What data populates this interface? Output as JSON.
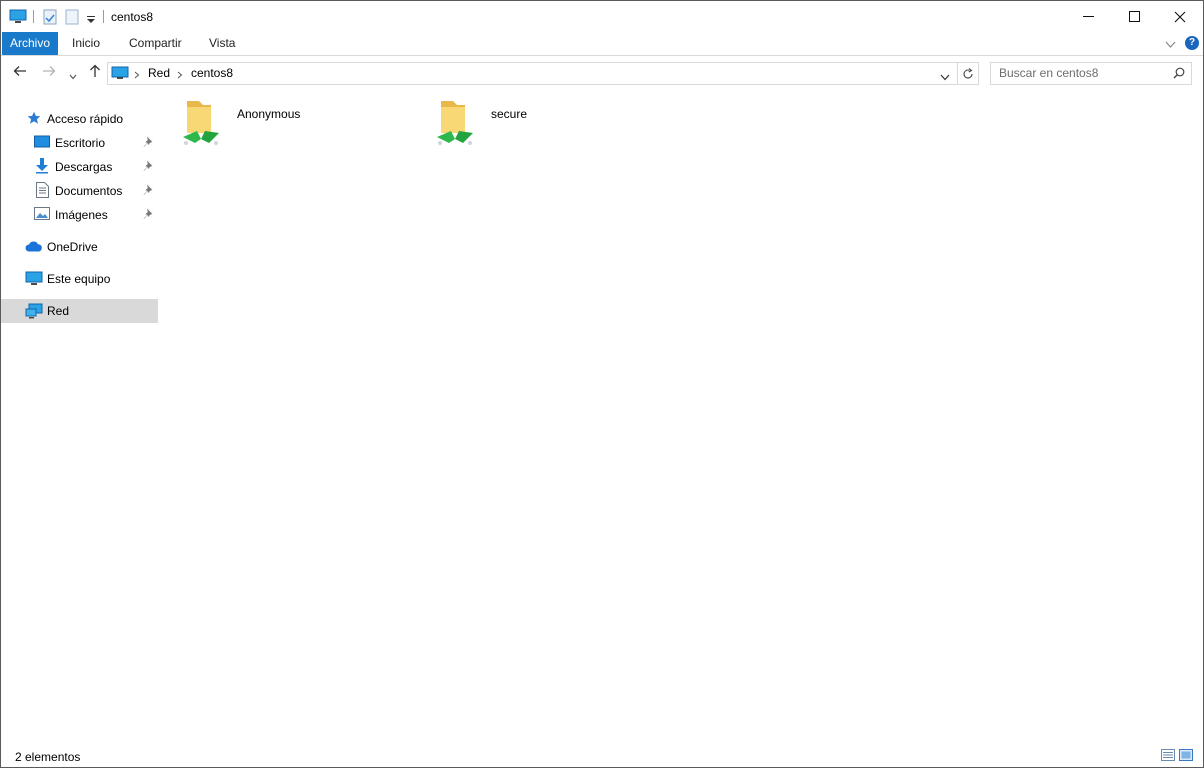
{
  "window": {
    "title": "centos8",
    "controls": [
      "minimize",
      "maximize",
      "close"
    ]
  },
  "quick_access_toolbar": {
    "icons": [
      "this-pc-icon",
      "properties-icon",
      "new-folder-icon",
      "customize-dropdown-icon"
    ]
  },
  "ribbon": {
    "tabs": [
      {
        "label": "Archivo",
        "active": true
      },
      {
        "label": "Inicio",
        "active": false
      },
      {
        "label": "Compartir",
        "active": false
      },
      {
        "label": "Vista",
        "active": false
      }
    ],
    "help_label": "?"
  },
  "address_bar": {
    "breadcrumbs": [
      "Red",
      "centos8"
    ],
    "search_placeholder": "Buscar en centos8"
  },
  "sidebar": {
    "quick_access": {
      "label": "Acceso rápido",
      "items": [
        {
          "label": "Escritorio",
          "icon": "desktop-icon",
          "pinned": true
        },
        {
          "label": "Descargas",
          "icon": "downloads-icon",
          "pinned": true
        },
        {
          "label": "Documentos",
          "icon": "documents-icon",
          "pinned": true
        },
        {
          "label": "Imágenes",
          "icon": "pictures-icon",
          "pinned": true
        }
      ]
    },
    "onedrive": {
      "label": "OneDrive"
    },
    "this_pc": {
      "label": "Este equipo"
    },
    "network": {
      "label": "Red",
      "selected": true
    }
  },
  "content": {
    "items": [
      {
        "name": "Anonymous",
        "icon": "network-share-folder-icon"
      },
      {
        "name": "secure",
        "icon": "network-share-folder-icon"
      }
    ]
  },
  "status_bar": {
    "item_count": "2 elementos"
  },
  "colors": {
    "accent": "#1979ca",
    "selected_bg": "#d9d9d9",
    "folder": "#f8d775",
    "share_green": "#2eb84b"
  }
}
